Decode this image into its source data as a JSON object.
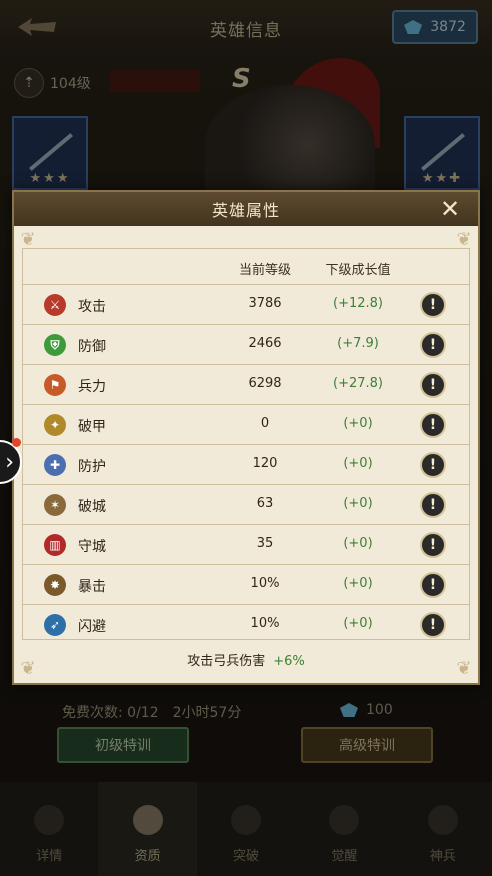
{
  "header": {
    "title": "英雄信息",
    "gems": "3872"
  },
  "hero": {
    "level": "104级",
    "grade": "S",
    "weapon_left_stars": "★★★",
    "weapon_right_stars": "★★✚"
  },
  "training": {
    "free_count": "免费次数: 0/12",
    "timer": "2小时57分",
    "gem_cost": "100",
    "basic_btn": "初级特训",
    "advanced_btn": "高级特训"
  },
  "bottom_nav": [
    {
      "label": "详情"
    },
    {
      "label": "资质"
    },
    {
      "label": "突破"
    },
    {
      "label": "觉醒"
    },
    {
      "label": "神兵"
    }
  ],
  "dialog": {
    "title": "英雄属性",
    "col_current": "当前等级",
    "col_next": "下级成长值",
    "rows": [
      {
        "name": "攻击",
        "current": "3786",
        "next": "(+12.8)",
        "icon": "sword-icon",
        "color": "#b83a2b"
      },
      {
        "name": "防御",
        "current": "2466",
        "next": "(+7.9)",
        "icon": "shield-icon",
        "color": "#3f9b3a"
      },
      {
        "name": "兵力",
        "current": "6298",
        "next": "(+27.8)",
        "icon": "flag-icon",
        "color": "#c85a2a"
      },
      {
        "name": "破甲",
        "current": "0",
        "next": "(+0)",
        "icon": "pierce-icon",
        "color": "#b08a2a"
      },
      {
        "name": "防护",
        "current": "120",
        "next": "(+0)",
        "icon": "guard-icon",
        "color": "#4a6fb0"
      },
      {
        "name": "破城",
        "current": "63",
        "next": "(+0)",
        "icon": "ram-icon",
        "color": "#8a6a3a"
      },
      {
        "name": "守城",
        "current": "35",
        "next": "(+0)",
        "icon": "tower-icon",
        "color": "#b02a2a"
      },
      {
        "name": "暴击",
        "current": "10%",
        "next": "(+0)",
        "icon": "crit-icon",
        "color": "#7a5a2a"
      },
      {
        "name": "闪避",
        "current": "10%",
        "next": "(+0)",
        "icon": "dodge-icon",
        "color": "#2e6fa8"
      }
    ],
    "footer_label": "攻击弓兵伤害",
    "footer_bonus": "+6%"
  }
}
